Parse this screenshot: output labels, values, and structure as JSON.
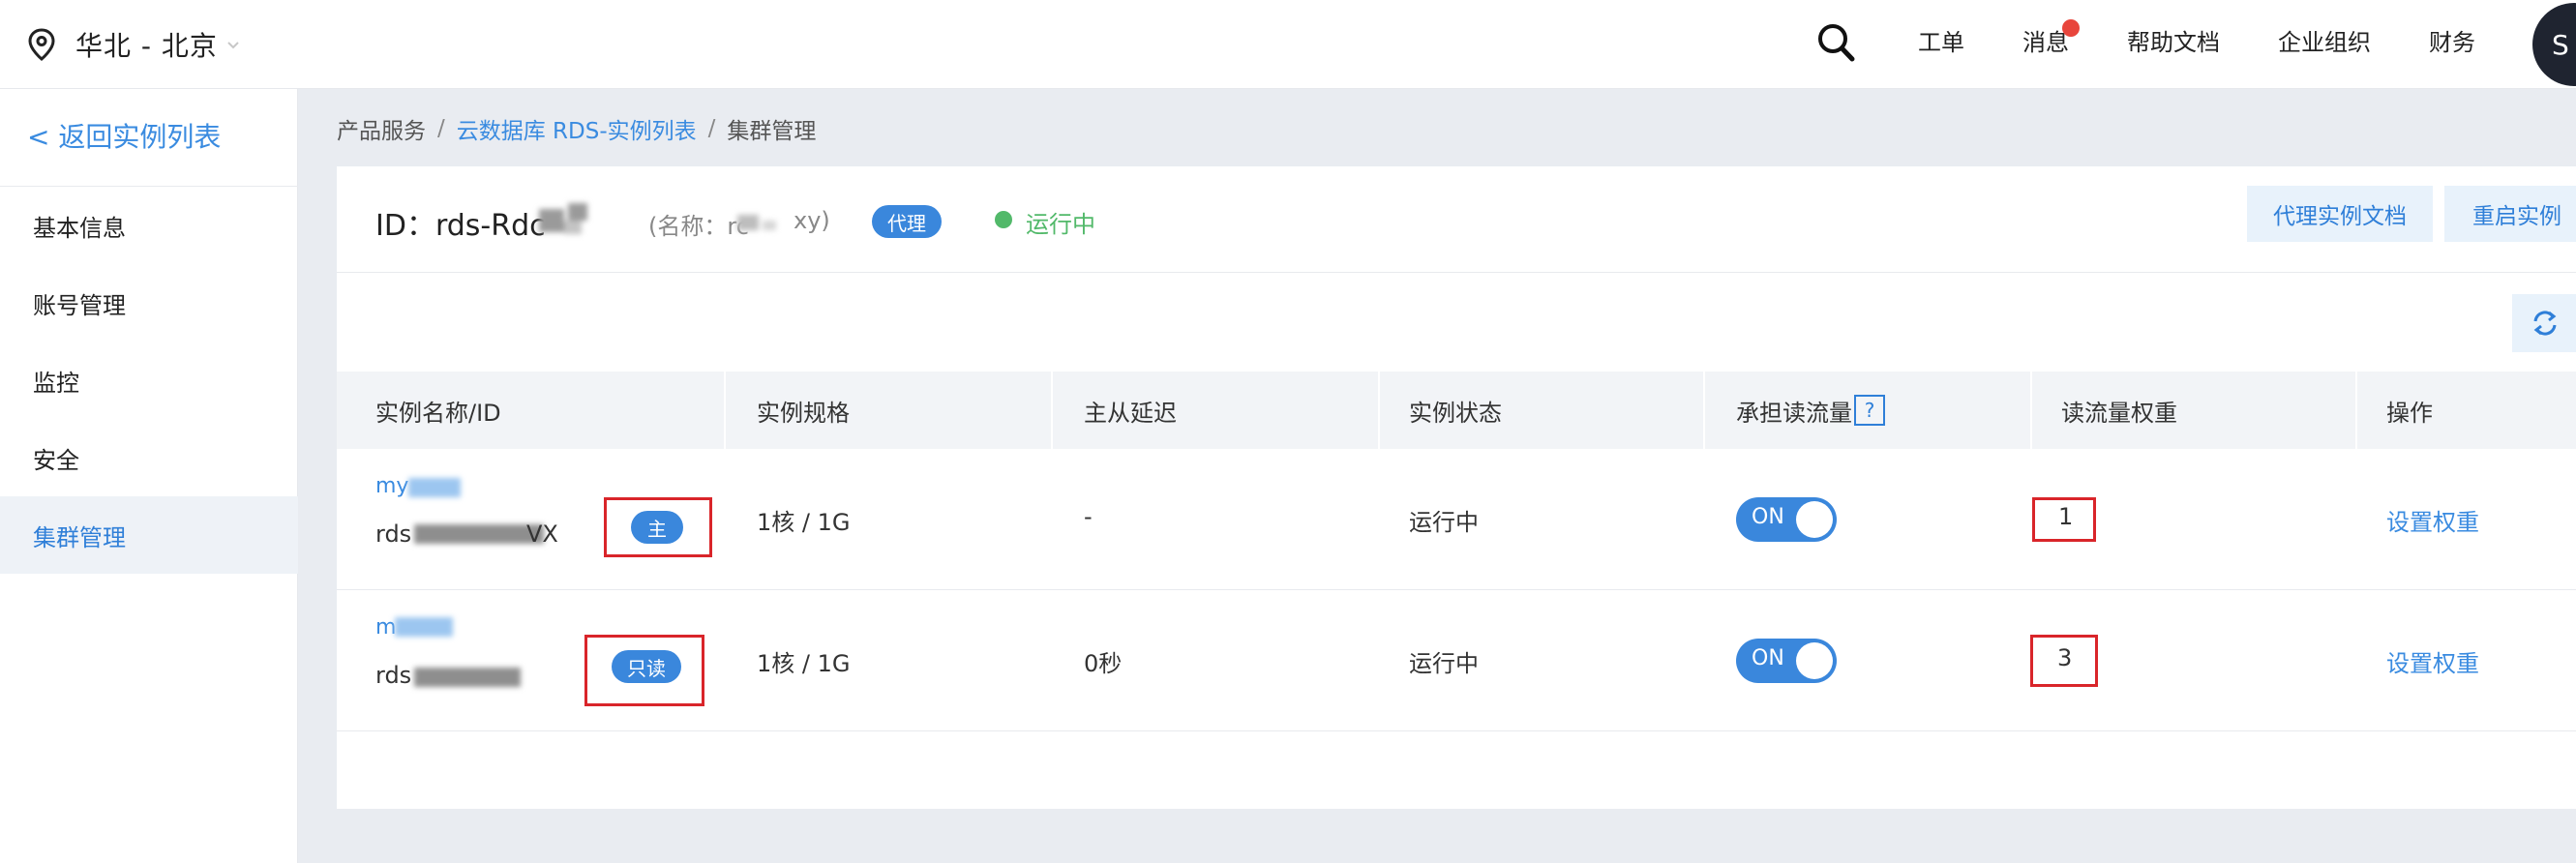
{
  "topbar": {
    "region": "华北 - 北京",
    "nav": [
      "工单",
      "消息",
      "帮助文档",
      "企业组织",
      "财务"
    ],
    "avatar_letter": "S"
  },
  "sidebar": {
    "back": "< 返回实例列表",
    "items": [
      "基本信息",
      "账号管理",
      "监控",
      "安全",
      "集群管理"
    ],
    "active": "集群管理"
  },
  "breadcrumb": [
    "产品服务",
    "云数据库 RDS-实例列表",
    "集群管理"
  ],
  "instance": {
    "id_label": "ID：rds-Rdc",
    "alias_prefix": "(名称：rc",
    "alias_suffix": "xy)",
    "tag": "代理",
    "status": "运行中",
    "status_color": "#52b96a"
  },
  "header_buttons": [
    "代理实例文档",
    "重启实例"
  ],
  "table": {
    "columns": [
      "实例名称/ID",
      "实例规格",
      "主从延迟",
      "实例状态",
      "承担读流量",
      "读流量权重",
      "操作"
    ],
    "help_icon": "?",
    "rows": [
      {
        "name": "my",
        "id_prefix": "rds",
        "id_suffix": "VX",
        "role": "主",
        "spec": "1核 / 1G",
        "delay": "-",
        "state": "运行中",
        "read_traffic": "ON",
        "weight": "1",
        "action": "设置权重"
      },
      {
        "name": "m",
        "id_prefix": "rds",
        "id_suffix": "",
        "role": "只读",
        "spec": "1核 / 1G",
        "delay": "0秒",
        "state": "运行中",
        "read_traffic": "ON",
        "weight": "3",
        "action": "设置权重"
      }
    ]
  },
  "colors": {
    "accent": "#3a87dc",
    "highlight": "#d9252a",
    "badge_dot": "#e8453c"
  }
}
